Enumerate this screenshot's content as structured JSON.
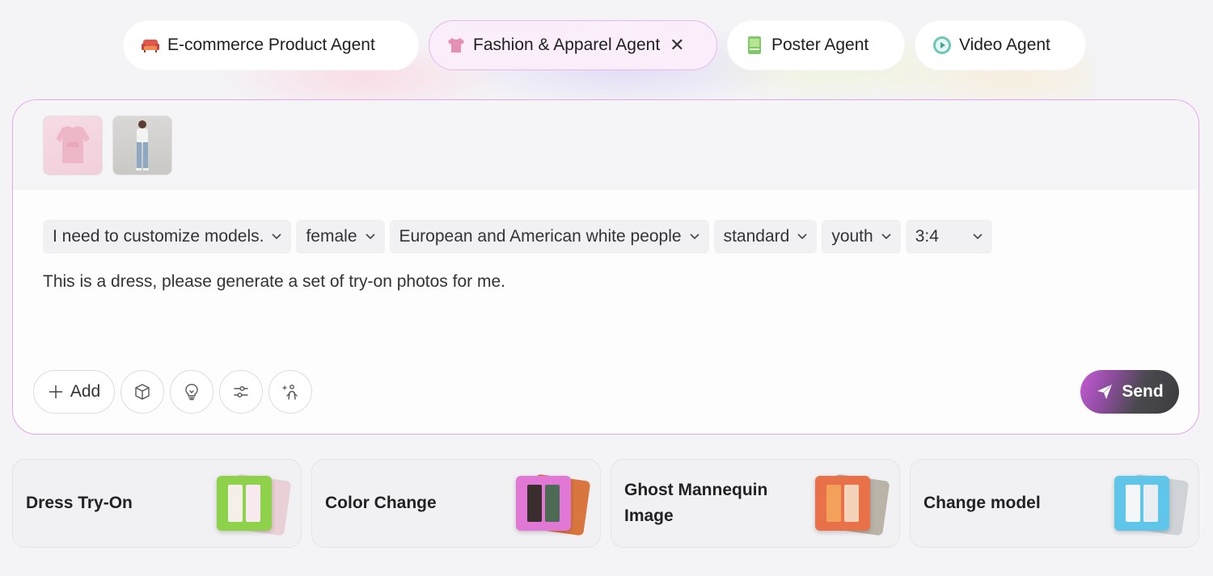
{
  "tabs": [
    {
      "label": "E-commerce Product Agent",
      "icon": "sofa-icon",
      "active": false
    },
    {
      "label": "Fashion & Apparel Agent",
      "icon": "tshirt-icon",
      "active": true,
      "close": "✕"
    },
    {
      "label": "Poster Agent",
      "icon": "poster-icon",
      "active": false
    },
    {
      "label": "Video Agent",
      "icon": "play-icon",
      "active": false
    }
  ],
  "composer": {
    "chips": [
      {
        "label": "I need to customize models."
      },
      {
        "label": "female"
      },
      {
        "label": "European and American white people"
      },
      {
        "label": "standard"
      },
      {
        "label": "youth"
      },
      {
        "label": "3:4"
      }
    ],
    "prompt": "This is a dress, please generate a set of try-on photos for me.",
    "add_label": "Add",
    "send_label": "Send"
  },
  "cards": [
    {
      "label": "Dress Try-On",
      "color": "#8ed14a"
    },
    {
      "label": "Color Change",
      "color": "#e278d6"
    },
    {
      "label": "Ghost Mannequin Image",
      "color": "#e9714a"
    },
    {
      "label": "Change model",
      "color": "#5fc6ea"
    }
  ]
}
